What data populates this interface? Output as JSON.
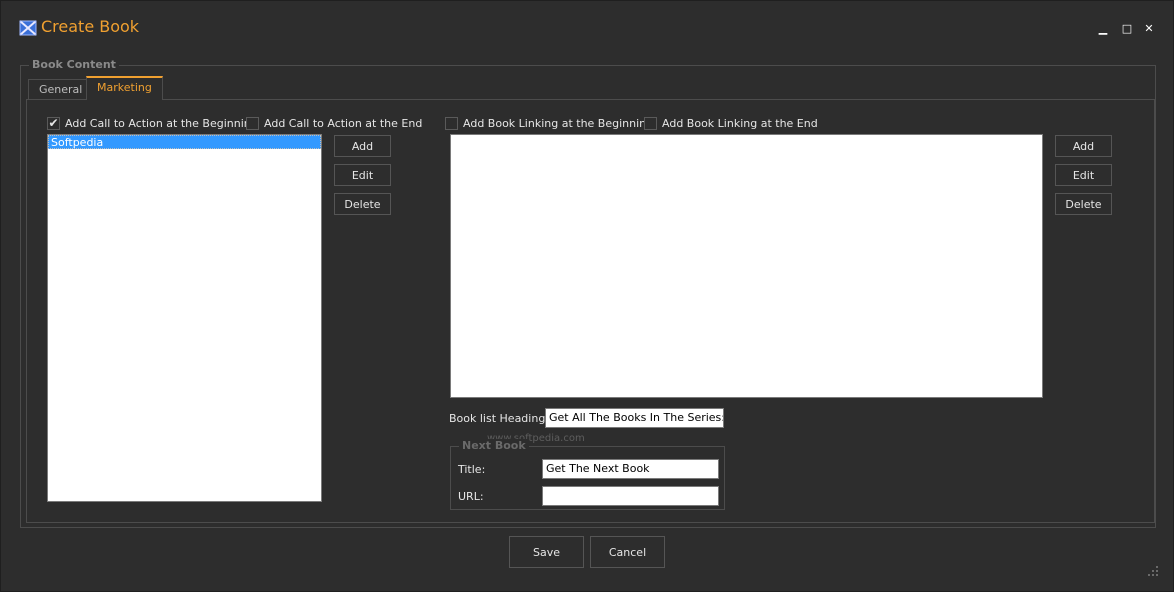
{
  "window": {
    "title": "Create Book",
    "accent_color": "#f0a030",
    "controls": {
      "minimize": "▁",
      "maximize": "□",
      "close": "✕"
    }
  },
  "group": {
    "legend": "Book Content"
  },
  "tabs": [
    {
      "label": "General",
      "active": false
    },
    {
      "label": "Marketing",
      "active": true
    }
  ],
  "call_to_action": {
    "beginning": {
      "label": "Add Call to Action at the Beginning",
      "checked": true,
      "mark": "✔"
    },
    "end": {
      "label": "Add Call to Action at the End",
      "checked": false
    },
    "items": [
      "Softpedia"
    ],
    "buttons": {
      "add": "Add",
      "edit": "Edit",
      "delete": "Delete"
    }
  },
  "book_linking": {
    "beginning": {
      "label": "Add Book Linking at the Beginning",
      "checked": false
    },
    "end": {
      "label": "Add Book Linking at the End",
      "checked": false
    },
    "items": [],
    "buttons": {
      "add": "Add",
      "edit": "Edit",
      "delete": "Delete"
    }
  },
  "book_list_heading": {
    "label": "Book list Heading:",
    "value": "Get All The Books In The Series:"
  },
  "next_book": {
    "legend": "Next Book",
    "title_label": "Title:",
    "title_value": "Get The Next Book",
    "url_label": "URL:",
    "url_value": ""
  },
  "footer": {
    "save": "Save",
    "cancel": "Cancel"
  },
  "watermark": {
    "text": "www.softpedia.com"
  }
}
